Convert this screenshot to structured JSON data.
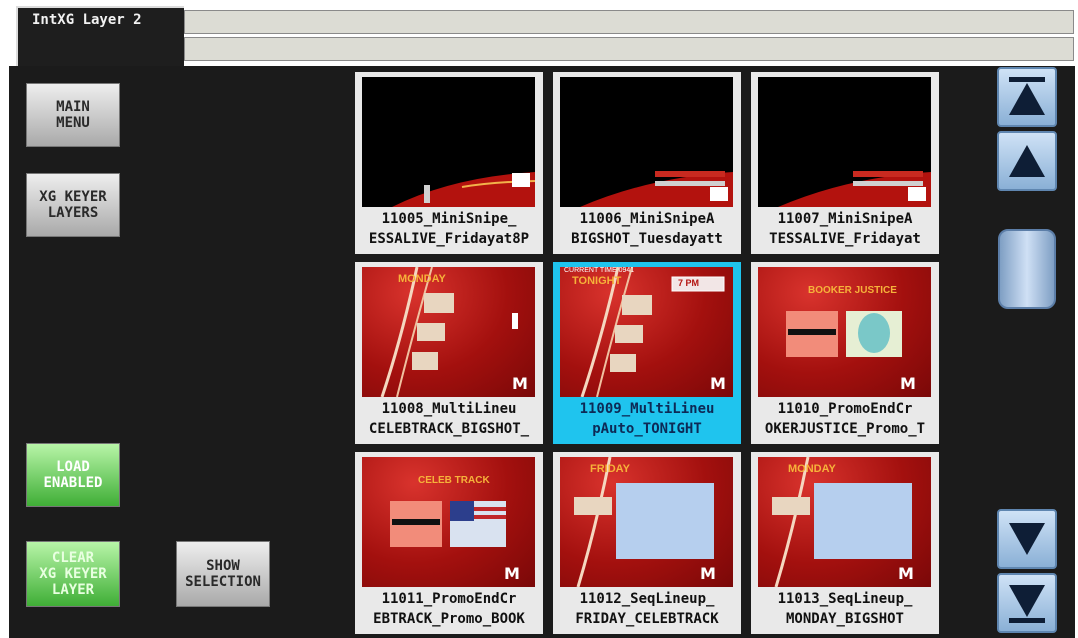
{
  "window": {
    "tab_title": "IntXG Layer 2"
  },
  "left_panel": {
    "main_menu_label": "MAIN\nMENU",
    "xg_keyer_layers_label": "XG KEYER\nLAYERS",
    "load_enabled_label": "LOAD\nENABLED",
    "clear_layer_label": "CLEAR\nXG KEYER\nLAYER",
    "show_selection_label": "SHOW\nSELECTION"
  },
  "thumbnails": [
    {
      "line1": "11005_MiniSnipe_",
      "line2": "ESSALIVE_Fridayat8P",
      "selected": false
    },
    {
      "line1": "11006_MiniSnipeA",
      "line2": "BIGSHOT_Tuesdayatt",
      "selected": false
    },
    {
      "line1": "11007_MiniSnipeA",
      "line2": "TESSALIVE_Fridayat",
      "selected": false
    },
    {
      "line1": "11008_MultiLineu",
      "line2": "CELEBTRACK_BIGSHOT_",
      "selected": false,
      "graphic_title": "MONDAY"
    },
    {
      "line1": "11009_MultiLineu",
      "line2": "pAuto_TONIGHT",
      "selected": true,
      "graphic_title": "TONIGHT",
      "graphic_caption": "CURRENT TIME 0941",
      "graphic_time": "7 PM"
    },
    {
      "line1": "11010_PromoEndCr",
      "line2": "OKERJUSTICE_Promo_T",
      "selected": false,
      "graphic_title": "BOOKER JUSTICE"
    },
    {
      "line1": "11011_PromoEndCr",
      "line2": "EBTRACK_Promo_BOOK",
      "selected": false,
      "graphic_title": "CELEB TRACK"
    },
    {
      "line1": "11012_SeqLineup_",
      "line2": "FRIDAY_CELEBTRACK",
      "selected": false,
      "graphic_title": "FRIDAY"
    },
    {
      "line1": "11013_SeqLineup_",
      "line2": "MONDAY_BIGSHOT",
      "selected": false,
      "graphic_title": "MONDAY"
    }
  ],
  "scroll": {
    "top_icon": "scroll-top-icon",
    "up_icon": "scroll-up-icon",
    "down_icon": "scroll-down-icon",
    "bottom_icon": "scroll-bottom-icon"
  },
  "colors": {
    "panel_bg": "#1b1b1b",
    "selected_border": "#1fc4ee",
    "green_button": "#3fae36",
    "scroll_button": "#8ab0d6",
    "graphic_red": "#b5130f"
  }
}
